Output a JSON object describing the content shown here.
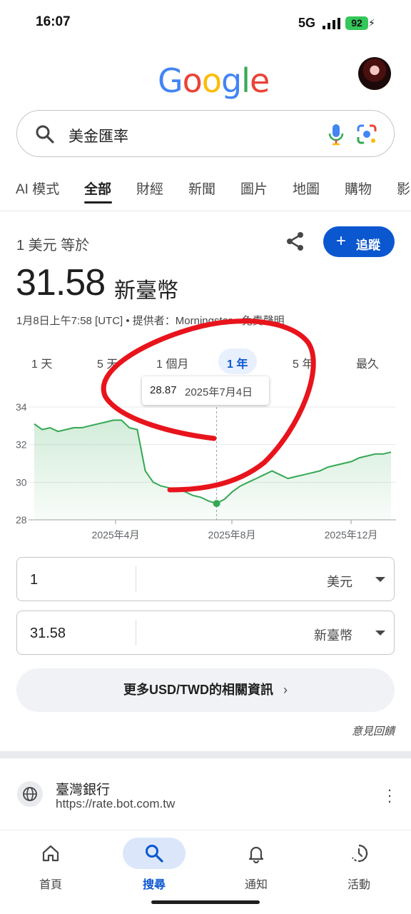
{
  "status_bar": {
    "time": "16:07",
    "network": "5G",
    "battery": "92"
  },
  "logo": {
    "letters": [
      "G",
      "o",
      "o",
      "g",
      "l",
      "e"
    ],
    "colors": [
      "#4285F4",
      "#EA4335",
      "#FBBC05",
      "#4285F4",
      "#34A853",
      "#EA4335"
    ]
  },
  "search": {
    "query": "美金匯率"
  },
  "tabs": [
    {
      "label": "AI 模式",
      "active": false
    },
    {
      "label": "全部",
      "active": true
    },
    {
      "label": "財經",
      "active": false
    },
    {
      "label": "新聞",
      "active": false
    },
    {
      "label": "圖片",
      "active": false
    },
    {
      "label": "地圖",
      "active": false
    },
    {
      "label": "購物",
      "active": false
    },
    {
      "label": "影",
      "active": false
    }
  ],
  "currency": {
    "equals_label": "1 美元 等於",
    "follow_label": "追蹤",
    "value": "31.58",
    "unit": "新臺幣",
    "meta": "1月8日上午7:58 [UTC] • 提供者：Morningstar • 免責聲明"
  },
  "ranges": [
    "1 天",
    "5 天",
    "1 個月",
    "1 年",
    "5 年",
    "最久"
  ],
  "selected_range": "1 年",
  "chart_data": {
    "type": "area",
    "series": [
      {
        "values": [
          33.1,
          32.8,
          32.9,
          32.7,
          32.8,
          32.9,
          32.9,
          33.0,
          33.1,
          33.2,
          33.3,
          33.3,
          32.9,
          32.8,
          30.6,
          30.0,
          29.8,
          29.7,
          29.6,
          29.5,
          29.3,
          29.2,
          29.0,
          28.87,
          29.1,
          29.5,
          29.8,
          30.0,
          30.2,
          30.4,
          30.6,
          30.4,
          30.2,
          30.3,
          30.4,
          30.5,
          30.6,
          30.8,
          30.9,
          31.0,
          31.1,
          31.3,
          31.4,
          31.5,
          31.5,
          31.6
        ]
      }
    ],
    "y_ticks": [
      "34",
      "32",
      "30",
      "28"
    ],
    "ylim": [
      28,
      34
    ],
    "x_ticks": [
      "2025年4月",
      "2025年8月",
      "2025年12月"
    ],
    "tooltip": {
      "value": "28.87",
      "date": "2025年7月4日"
    },
    "color": "#34a853"
  },
  "converter": [
    {
      "amount": "1",
      "currency": "美元"
    },
    {
      "amount": "31.58",
      "currency": "新臺幣"
    }
  ],
  "more_info": "更多USD/TWD的相關資訊",
  "feedback": "意見回饋",
  "result": {
    "site": "臺灣銀行",
    "url": "https://rate.bot.com.tw"
  },
  "bottom_nav": [
    {
      "label": "首頁",
      "icon": "home-icon"
    },
    {
      "label": "搜尋",
      "icon": "search-icon",
      "active": true
    },
    {
      "label": "通知",
      "icon": "bell-icon"
    },
    {
      "label": "活動",
      "icon": "history-icon"
    }
  ],
  "annotation_color": "#e8141c"
}
